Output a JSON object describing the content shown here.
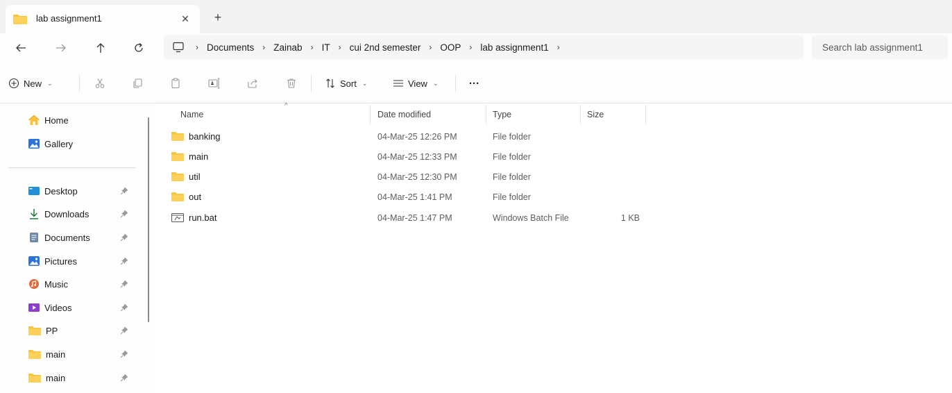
{
  "window": {
    "tab_title": "lab assignment1",
    "tab_close": "✕",
    "new_tab": "+"
  },
  "navigation": {
    "back": "←",
    "forward": "→",
    "up": "↑",
    "refresh": "⟳"
  },
  "breadcrumb": {
    "items": [
      "Documents",
      "Zainab",
      "IT",
      "cui 2nd semester",
      "OOP",
      "lab assignment1"
    ]
  },
  "search": {
    "placeholder": "Search lab assignment1"
  },
  "toolbar": {
    "new_label": "New",
    "sort_label": "Sort",
    "view_label": "View",
    "more_label": "···",
    "icons": [
      "cut-icon",
      "copy-icon",
      "paste-icon",
      "rename-icon",
      "share-icon",
      "delete-icon"
    ]
  },
  "sidebar": {
    "top_items": [
      {
        "label": "Home",
        "icon": "home-icon"
      },
      {
        "label": "Gallery",
        "icon": "gallery-icon"
      }
    ],
    "pinned_items": [
      {
        "label": "Desktop",
        "icon": "desktop-icon"
      },
      {
        "label": "Downloads",
        "icon": "downloads-icon"
      },
      {
        "label": "Documents",
        "icon": "documents-icon"
      },
      {
        "label": "Pictures",
        "icon": "pictures-icon"
      },
      {
        "label": "Music",
        "icon": "music-icon"
      },
      {
        "label": "Videos",
        "icon": "videos-icon"
      },
      {
        "label": "PP",
        "icon": "folder-icon"
      },
      {
        "label": "main",
        "icon": "folder-icon"
      },
      {
        "label": "main",
        "icon": "folder-icon"
      }
    ]
  },
  "file_list": {
    "columns": [
      "Name",
      "Date modified",
      "Type",
      "Size"
    ],
    "rows": [
      {
        "name": "banking",
        "date": "04-Mar-25 12:26 PM",
        "type": "File folder",
        "size": "",
        "icon": "folder-icon"
      },
      {
        "name": "main",
        "date": "04-Mar-25 12:33 PM",
        "type": "File folder",
        "size": "",
        "icon": "folder-icon"
      },
      {
        "name": "util",
        "date": "04-Mar-25 12:30 PM",
        "type": "File folder",
        "size": "",
        "icon": "folder-icon"
      },
      {
        "name": "out",
        "date": "04-Mar-25 1:41 PM",
        "type": "File folder",
        "size": "",
        "icon": "folder-icon"
      },
      {
        "name": "run.bat",
        "date": "04-Mar-25 1:47 PM",
        "type": "Windows Batch File",
        "size": "1 KB",
        "icon": "batch-file-icon"
      }
    ]
  },
  "colors": {
    "folder": "#f9c33a",
    "folder_dark": "#e8a91f",
    "accent": "#0067c0"
  }
}
